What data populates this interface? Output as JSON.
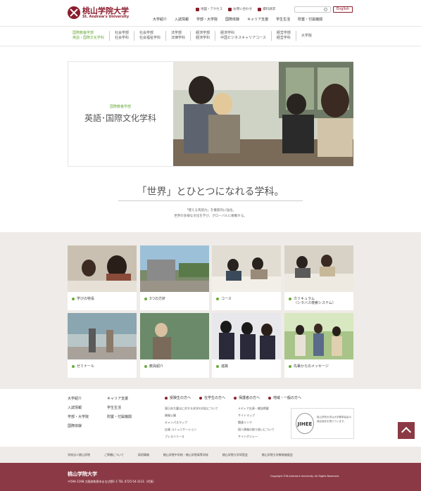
{
  "header": {
    "logo_jp": "桃山学院大学",
    "logo_en": "St. Andrew's University",
    "utility": [
      "地図・アクセス",
      "お問い合わせ",
      "資料請求"
    ],
    "english": "English",
    "gnav": [
      "大学紹介",
      "入試情報",
      "学部・大学院",
      "国際体験",
      "キャリア支援",
      "学生生活",
      "附置・付属機関"
    ]
  },
  "subnav": [
    {
      "line1": "国際教養学部",
      "line2": "英語・国際文化学科",
      "active": true
    },
    {
      "line1": "社会学部",
      "line2": "社会学科"
    },
    {
      "line1": "社会学部",
      "line2": "社会福祉学科"
    },
    {
      "line1": "法学部",
      "line2": "法律学科"
    },
    {
      "line1": "経済学部",
      "line2": "経済学科"
    },
    {
      "line1": "経済学科",
      "line2": "中国ビジネスキャリアコース"
    },
    {
      "line1": "経営学部",
      "line2": "経営学科"
    },
    {
      "line1": "大学院",
      "line2": ""
    }
  ],
  "hero": {
    "sub": "国際教養学部",
    "title": "英語･国際文化学科"
  },
  "catch": "「世界」とひとつになれる学科。",
  "lead": [
    "「使える英語力」を徹底的に強化。",
    "世界の多様な文化を学び、グローバルに挑戦する。"
  ],
  "cards": [
    {
      "label": "学びの特長",
      "label2": ""
    },
    {
      "label": "3つの方針",
      "label2": ""
    },
    {
      "label": "コース",
      "label2": ""
    },
    {
      "label": "カリキュラム",
      "label2": "（シラバス検索システム）"
    },
    {
      "label": "ゼミナール",
      "label2": ""
    },
    {
      "label": "教員紹介",
      "label2": ""
    },
    {
      "label": "進路",
      "label2": ""
    },
    {
      "label": "先輩からのメッセージ",
      "label2": ""
    }
  ],
  "footer_col1": [
    "大学紹介",
    "入試情報",
    "学部・大学院",
    "国際体験"
  ],
  "footer_col2": [
    "キャリア支援",
    "学生生活",
    "附置・付属機関"
  ],
  "audience": [
    "受験生の方へ",
    "在学生の方へ",
    "保護者の方へ",
    "地域・一般の方へ"
  ],
  "flist1": [
    "東日本大震災に対する本学の対応について",
    "情報公開",
    "キャンパスマップ",
    "広報 コミュニケーション",
    "プレスリリース"
  ],
  "flist2": [
    "メディア出演・雑誌掲載",
    "サイトマップ",
    "関連リンク",
    "個人情報の取り扱いについて",
    "サイトポリシー"
  ],
  "badge": {
    "seal": "JIHEE",
    "text": "桃山学院大学は大学基準協会の適合認定を受けています。"
  },
  "bottomnav": [
    "学校法人桃山学院",
    "ご寄贈について",
    "採用情報",
    "桃山学院中学校・桃山学院高等学校",
    "桃山学院大学同窓会",
    "桃山学院大学教育後援会"
  ],
  "footer": {
    "name": "桃山学院大学",
    "addr": "〒594-1198 大阪府和泉市まなび野1-1 TEL 0725-54-3131（代表）",
    "copy": "Copyright ©St.Andrew's University. All Rights Reserved."
  },
  "colors": {
    "brand": "#8b1d2c",
    "accent": "#6aaa3a",
    "footer": "#8b3a45"
  }
}
